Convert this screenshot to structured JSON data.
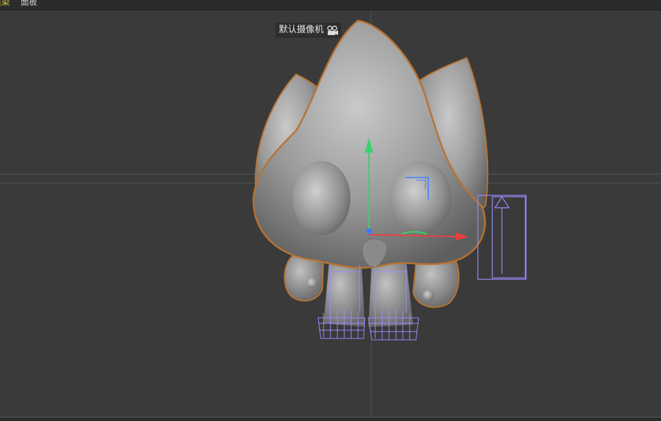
{
  "menubar": {
    "items": [
      {
        "label": "渲染",
        "color": "#e0d23a"
      },
      {
        "label": "面板",
        "color": "#cfcfcf"
      }
    ]
  },
  "viewport": {
    "camera_label": "默认摄像机",
    "camera_icon": "camera-icon"
  },
  "colors": {
    "background": "#3a3a3a",
    "model_outline": "#b87333",
    "wireframe": "#9b8cff",
    "axis_x": "#e84040",
    "axis_y": "#35d46a",
    "axis_z": "#3a7bff"
  }
}
